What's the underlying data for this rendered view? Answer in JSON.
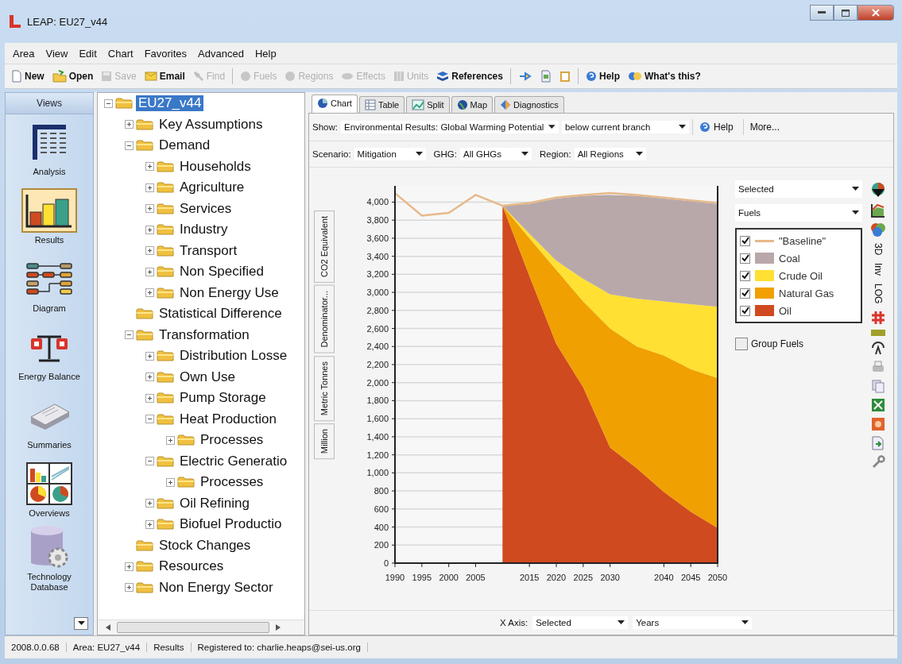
{
  "window": {
    "title": "LEAP: EU27_v44"
  },
  "menu": [
    "Area",
    "View",
    "Edit",
    "Chart",
    "Favorites",
    "Advanced",
    "Help"
  ],
  "toolbar_groups": [
    {
      "items": [
        {
          "label": "New",
          "disabled": false
        },
        {
          "label": "Open",
          "disabled": false
        },
        {
          "label": "Save",
          "disabled": true
        },
        {
          "label": "Email",
          "disabled": false
        },
        {
          "label": "Find",
          "disabled": true
        }
      ]
    },
    {
      "items": [
        {
          "label": "Fuels",
          "disabled": true
        },
        {
          "label": "Regions",
          "disabled": true
        },
        {
          "label": "Effects",
          "disabled": true
        },
        {
          "label": "Units",
          "disabled": true
        },
        {
          "label": "References",
          "disabled": false
        }
      ]
    },
    {
      "items": [
        {
          "disabled": false
        },
        {
          "disabled": false
        },
        {
          "disabled": false
        }
      ]
    },
    {
      "items": [
        {
          "label": "Help",
          "disabled": false
        },
        {
          "label": "What's this?",
          "disabled": false
        }
      ]
    }
  ],
  "views": {
    "title": "Views",
    "items": [
      {
        "label": "Analysis",
        "selected": false
      },
      {
        "label": "Results",
        "selected": true
      },
      {
        "label": "Diagram",
        "selected": false
      },
      {
        "label": "Energy Balance",
        "selected": false
      },
      {
        "label": "Summaries",
        "selected": false
      },
      {
        "label": "Overviews",
        "selected": false
      },
      {
        "label": "Technology Database",
        "selected": false
      }
    ]
  },
  "tree": [
    {
      "label": "EU27_v44",
      "kind": "branch",
      "expanded": true,
      "selected": true,
      "children": [
        {
          "label": "Key Assumptions",
          "kind": "branch",
          "expanded": false,
          "selected": false
        },
        {
          "label": "Demand",
          "kind": "branch",
          "expanded": true,
          "selected": false,
          "children": [
            {
              "label": "Households",
              "kind": "branch",
              "expanded": false,
              "selected": false
            },
            {
              "label": "Agriculture",
              "kind": "branch",
              "expanded": false,
              "selected": false
            },
            {
              "label": "Services",
              "kind": "branch",
              "expanded": false,
              "selected": false
            },
            {
              "label": "Industry",
              "kind": "branch",
              "expanded": false,
              "selected": false
            },
            {
              "label": "Transport",
              "kind": "branch",
              "expanded": false,
              "selected": false
            },
            {
              "label": "Non Specified",
              "kind": "branch",
              "expanded": false,
              "selected": false
            },
            {
              "label": "Non Energy Use",
              "kind": "branch",
              "expanded": false,
              "selected": false
            }
          ]
        },
        {
          "label": "Statistical Difference",
          "kind": "leaf",
          "selected": false
        },
        {
          "label": "Transformation",
          "kind": "branch",
          "expanded": true,
          "selected": false,
          "children": [
            {
              "label": "Distribution Losse",
              "kind": "branch",
              "expanded": false,
              "selected": false
            },
            {
              "label": "Own Use",
              "kind": "branch",
              "expanded": false,
              "selected": false
            },
            {
              "label": "Pump Storage",
              "kind": "branch",
              "expanded": false,
              "selected": false
            },
            {
              "label": "Heat Production",
              "kind": "branch",
              "expanded": true,
              "selected": false,
              "children": [
                {
                  "label": "Processes",
                  "kind": "branch",
                  "expanded": false,
                  "selected": false
                }
              ]
            },
            {
              "label": "Electric Generatio",
              "kind": "branch",
              "expanded": true,
              "selected": false,
              "children": [
                {
                  "label": "Processes",
                  "kind": "branch",
                  "expanded": false,
                  "selected": false
                }
              ]
            },
            {
              "label": "Oil Refining",
              "kind": "branch",
              "expanded": false,
              "selected": false
            },
            {
              "label": "Biofuel Productio",
              "kind": "branch",
              "expanded": false,
              "selected": false
            }
          ]
        },
        {
          "label": "Stock Changes",
          "kind": "leaf",
          "selected": false
        },
        {
          "label": "Resources",
          "kind": "branch",
          "expanded": false,
          "selected": false
        },
        {
          "label": "Non Energy Sector",
          "kind": "branch",
          "expanded": false,
          "selected": false
        }
      ]
    }
  ],
  "tabs": [
    {
      "label": "Chart",
      "selected": true
    },
    {
      "label": "Table",
      "selected": false
    },
    {
      "label": "Split",
      "selected": false
    },
    {
      "label": "Map",
      "selected": false
    },
    {
      "label": "Diagnostics",
      "selected": false
    }
  ],
  "show": {
    "label": "Show:",
    "result": "Environmental Results: Global Warming Potential",
    "branch": "below current branch",
    "help": "Help",
    "more": "More..."
  },
  "filters": [
    {
      "label": "Scenario:",
      "value": "Mitigation"
    },
    {
      "label": "GHG:",
      "value": "All GHGs"
    },
    {
      "label": "Region:",
      "value": "All Regions"
    }
  ],
  "axis_tabs": [
    "CO2 Equivalent",
    "Denominator...",
    "Metric Tonnes",
    "Million"
  ],
  "chart": {
    "chart_data": {
      "type": "area",
      "stacked": true,
      "grid": true,
      "x": [
        1990,
        1995,
        2000,
        2005,
        2010,
        2015,
        2020,
        2025,
        2030,
        2035,
        2040,
        2045,
        2050
      ],
      "xlim": [
        1990,
        2050
      ],
      "ylim": [
        0,
        4180
      ],
      "xticks": [
        1990,
        1995,
        2000,
        2005,
        2015,
        2020,
        2025,
        2030,
        2040,
        2045,
        2050
      ],
      "yticks": [
        0,
        200,
        400,
        600,
        800,
        {
          "value": 1000,
          "label": "1,000"
        },
        {
          "value": 1200,
          "label": "1,200"
        },
        {
          "value": 1400,
          "label": "1,400"
        },
        {
          "value": 1600,
          "label": "1,600"
        },
        {
          "value": 1800,
          "label": "1,800"
        },
        {
          "value": 2000,
          "label": "2,000"
        },
        {
          "value": 2200,
          "label": "2,200"
        },
        {
          "value": 2400,
          "label": "2,400"
        },
        {
          "value": 2600,
          "label": "2,600"
        },
        {
          "value": 2800,
          "label": "2,800"
        },
        {
          "value": 3000,
          "label": "3,000"
        },
        {
          "value": 3200,
          "label": "3,200"
        },
        {
          "value": 3400,
          "label": "3,400"
        },
        {
          "value": 3600,
          "label": "3,600"
        },
        {
          "value": 3800,
          "label": "3,800"
        },
        {
          "value": 4000,
          "label": "4,000"
        }
      ],
      "series": [
        {
          "name": "Oil",
          "color": "#d04a1f",
          "values": [
            null,
            null,
            null,
            null,
            3960,
            3180,
            2430,
            1950,
            1280,
            1050,
            790,
            570,
            390
          ]
        },
        {
          "name": "Natural Gas",
          "color": "#f0a000",
          "values": [
            null,
            null,
            null,
            null,
            0,
            420,
            820,
            950,
            1320,
            1350,
            1510,
            1580,
            1660
          ]
        },
        {
          "name": "Crude Oil",
          "color": "#ffe033",
          "values": [
            null,
            null,
            null,
            null,
            0,
            50,
            100,
            250,
            380,
            530,
            600,
            720,
            790
          ]
        },
        {
          "name": "Coal",
          "color": "#b8a8aa",
          "values": [
            null,
            null,
            null,
            null,
            0,
            330,
            690,
            920,
            1100,
            1140,
            1140,
            1140,
            1140
          ]
        },
        {
          "name": "\"Baseline\"",
          "type": "line",
          "color": "#e6b98a",
          "values": [
            4100,
            3850,
            3880,
            4080,
            3960,
            3990,
            4050,
            4080,
            4100,
            4080,
            4050,
            4020,
            3990
          ]
        }
      ]
    },
    "group_by": "Selected",
    "dimension": "Fuels",
    "legend": [
      {
        "checked": true
      },
      {
        "checked": true
      },
      {
        "checked": true
      },
      {
        "checked": true
      },
      {
        "checked": true
      }
    ],
    "group_fuels": {
      "label": "Group Fuels",
      "checked": false
    }
  },
  "side_tools": [
    {
      "kind": "icon"
    },
    {
      "kind": "icon"
    },
    {
      "kind": "icon"
    },
    {
      "kind": "text",
      "label": "3D"
    },
    {
      "kind": "text",
      "label": "Inv"
    },
    {
      "kind": "text",
      "label": "LOG"
    },
    {
      "kind": "icon"
    },
    {
      "kind": "icon"
    },
    {
      "kind": "icon"
    },
    {
      "kind": "icon"
    },
    {
      "kind": "icon"
    },
    {
      "kind": "icon"
    },
    {
      "kind": "icon"
    },
    {
      "kind": "icon"
    },
    {
      "kind": "icon"
    }
  ],
  "x_axis": {
    "label": "X Axis:",
    "group_by": "Selected",
    "dimension": "Years"
  },
  "status_bar": [
    "2008.0.0.68",
    "Area: EU27_v44",
    "Results",
    "Registered to: charlie.heaps@sei-us.org"
  ]
}
